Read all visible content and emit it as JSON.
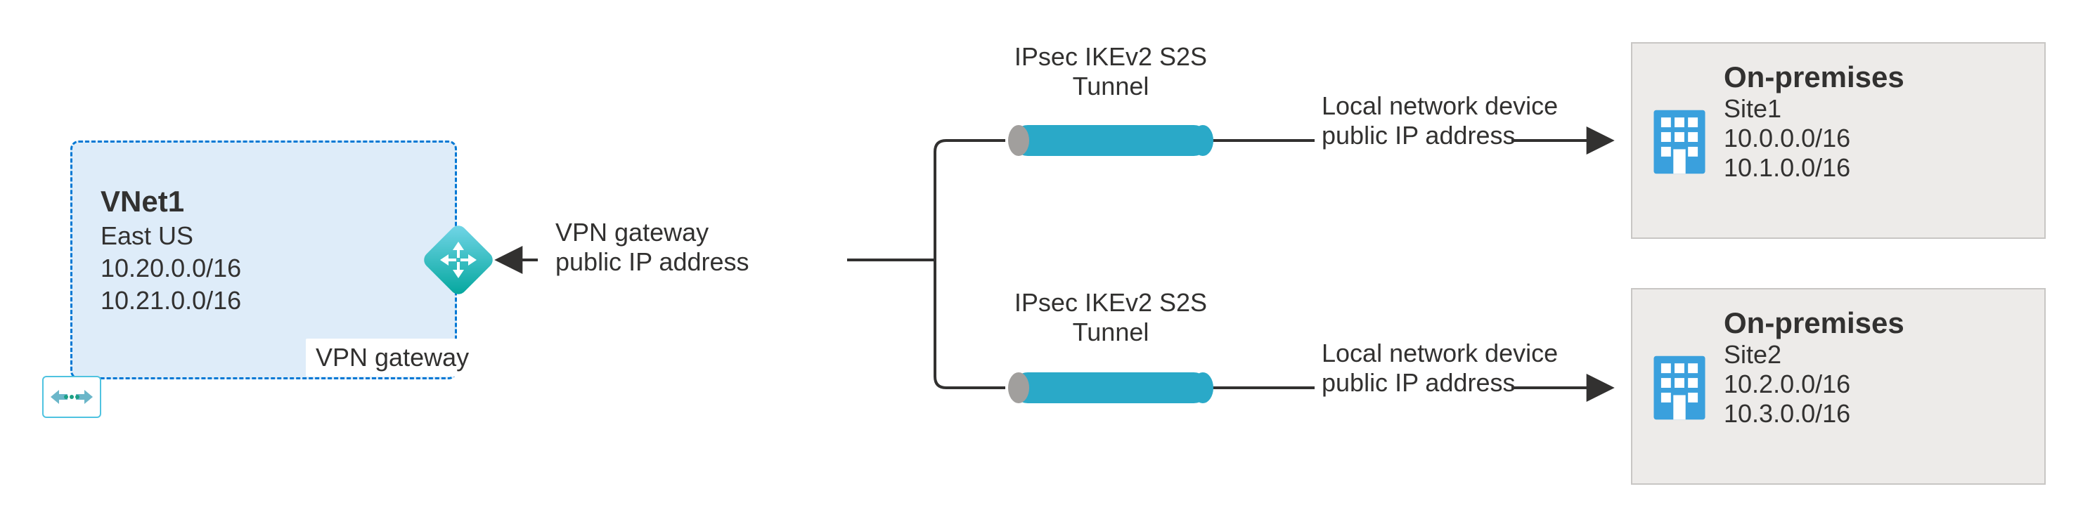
{
  "vnet": {
    "title": "VNet1",
    "region": "East US",
    "cidrs": [
      "10.20.0.0/16",
      "10.21.0.0/16"
    ]
  },
  "gateway": {
    "label": "VPN gateway",
    "ip_label_line1": "VPN gateway",
    "ip_label_line2": "public IP address"
  },
  "tunnels": [
    {
      "line1": "IPsec IKEv2 S2S",
      "line2": "Tunnel"
    },
    {
      "line1": "IPsec IKEv2 S2S",
      "line2": "Tunnel"
    }
  ],
  "local_labels": [
    {
      "line1": "Local network device",
      "line2": "public IP address"
    },
    {
      "line1": "Local network device",
      "line2": "public IP address"
    }
  ],
  "sites": [
    {
      "title": "On-premises",
      "name": "Site1",
      "cidrs": [
        "10.0.0.0/16",
        "10.1.0.0/16"
      ]
    },
    {
      "title": "On-premises",
      "name": "Site2",
      "cidrs": [
        "10.2.0.0/16",
        "10.3.0.0/16"
      ]
    }
  ],
  "colors": {
    "azure_blue": "#0078d4",
    "diagram_teal": "#2aa9c8",
    "box_grey": "#edebe9"
  }
}
